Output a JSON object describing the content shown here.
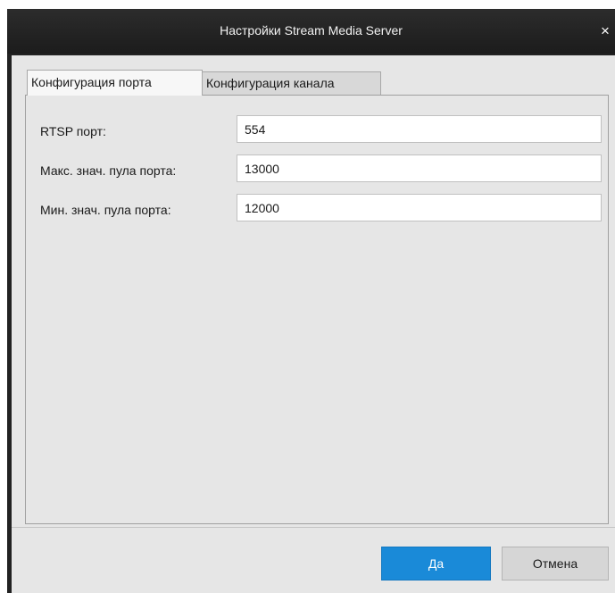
{
  "window": {
    "title": "Настройки Stream Media Server",
    "close_glyph": "×"
  },
  "tabs": [
    {
      "label": "Конфигурация порта",
      "active": true
    },
    {
      "label": "Конфигурация канала",
      "active": false
    }
  ],
  "form": {
    "rtsp_port": {
      "label": "RTSP порт:",
      "value": "554"
    },
    "max_pool": {
      "label": "Макс. знач. пула порта:",
      "value": "13000"
    },
    "min_pool": {
      "label": "Мин. знач. пула порта:",
      "value": "12000"
    }
  },
  "buttons": {
    "ok": "Да",
    "cancel": "Отмена"
  },
  "colors": {
    "titlebar": "#222222",
    "accent": "#1a8ad8",
    "client": "#e6e6e6"
  }
}
